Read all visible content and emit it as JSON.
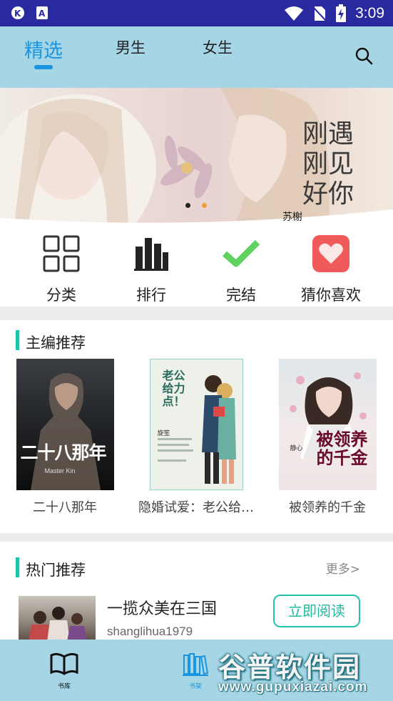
{
  "status_bar": {
    "time": "3:09",
    "icons": [
      "app-icon",
      "font-icon",
      "wifi-icon",
      "no-sim-icon",
      "battery-charging-icon"
    ]
  },
  "top_nav": {
    "tabs": [
      {
        "label": "精选",
        "active": true
      },
      {
        "label": "男生",
        "active": false
      },
      {
        "label": "女生",
        "active": false
      }
    ],
    "search_icon": "search-icon"
  },
  "banner": {
    "title_line1": "刚遇",
    "title_line2": "刚见",
    "title_line3": "好你",
    "author": "苏榭",
    "indicator_count": 2,
    "active_index": 1
  },
  "quick_links": [
    {
      "label": "分类",
      "icon": "grid-icon"
    },
    {
      "label": "排行",
      "icon": "bar-chart-icon"
    },
    {
      "label": "完结",
      "icon": "check-icon"
    },
    {
      "label": "猜你喜欢",
      "icon": "heart-icon"
    }
  ],
  "editor_picks": {
    "title": "主编推荐",
    "books": [
      {
        "title": "二十八那年",
        "cover_text": "二十八那年",
        "cover_author": "Master Kin"
      },
      {
        "title": "隐婚试爱：老公给…",
        "cover_text": "老公给力点！",
        "cover_author": "旋笙"
      },
      {
        "title": "被领养的千金",
        "cover_text": "被领养的千金",
        "cover_author": "静心"
      }
    ]
  },
  "hot_picks": {
    "title": "热门推荐",
    "more": "更多>",
    "items": [
      {
        "title": "一揽众美在三国",
        "author": "shanglihua1979",
        "button": "立即阅读"
      }
    ]
  },
  "bottom_nav": [
    {
      "label": "书库",
      "icon": "open-book-icon"
    },
    {
      "label": "书架",
      "icon": "bookshelf-icon"
    }
  ],
  "watermark": {
    "text": "谷普软件园",
    "url": "www.gupuxiazai.com"
  },
  "colors": {
    "accent": "#1a96e0",
    "teal": "#20c4a8",
    "nav_bg": "#a6d6e6",
    "status_bg": "#2a2aa0",
    "heart": "#f05a5a"
  }
}
